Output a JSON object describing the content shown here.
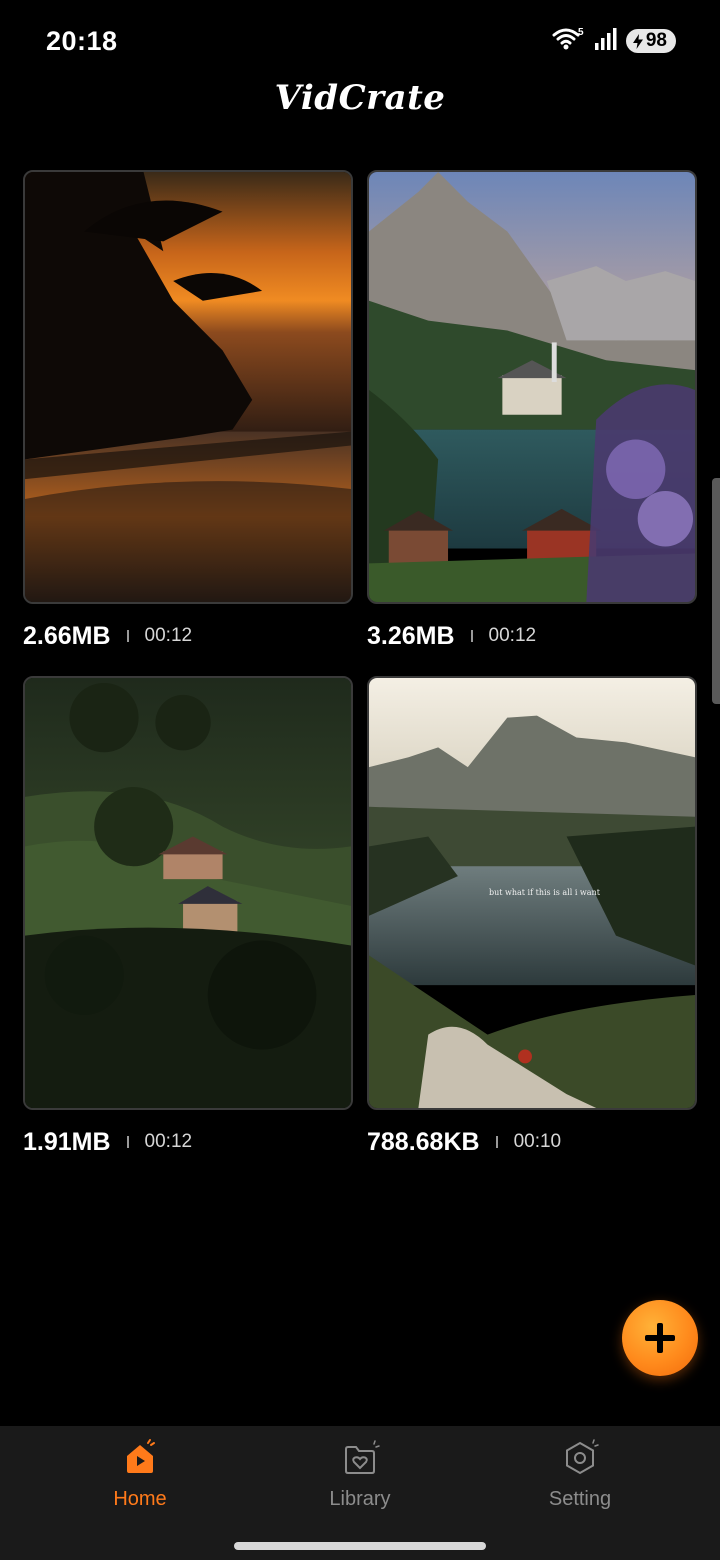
{
  "status": {
    "time": "20:18",
    "wifi_badge": "5",
    "battery": "98"
  },
  "app": {
    "title": "VidCrate"
  },
  "videos": [
    {
      "size": "2.66MB",
      "duration": "00:12",
      "thumbnail": "tropical beach sunset"
    },
    {
      "size": "3.26MB",
      "duration": "00:12",
      "thumbnail": "alpine lake village"
    },
    {
      "size": "1.91MB",
      "duration": "00:12",
      "thumbnail": "hillside houses at dusk"
    },
    {
      "size": "788.68KB",
      "duration": "00:10",
      "thumbnail": "mountain lake at sunrise",
      "overlay_text": "but what if this is all i want"
    }
  ],
  "fab": {
    "icon": "plus-icon"
  },
  "nav": {
    "active": "home",
    "accent_color": "#ff7a1a",
    "items": [
      {
        "label": "Home",
        "icon": "home-play-icon"
      },
      {
        "label": "Library",
        "icon": "folder-heart-icon"
      },
      {
        "label": "Setting",
        "icon": "hexagon-gear-icon"
      }
    ]
  }
}
